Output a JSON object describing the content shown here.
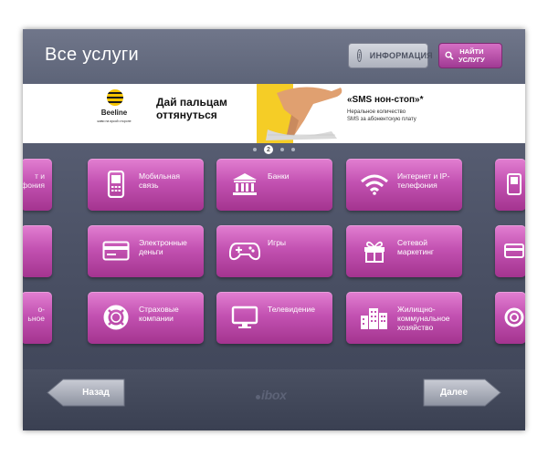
{
  "header": {
    "title": "Все услуги",
    "info_button": {
      "label": "ИНФОРМАЦИЯ",
      "icon": "info-icon"
    },
    "find_button": {
      "label_line1": "НАЙТИ",
      "label_line2": "УСЛУГУ",
      "icon": "search-icon"
    }
  },
  "banner": {
    "brand": "Beeline",
    "slogan": "живи на яркой стороне",
    "headline_line1": "Дай пальцам",
    "headline_line2": "оттянуться",
    "offer_title": "«SMS нон-стоп»*",
    "offer_line1": "Неральное количество",
    "offer_line2": "SMS за абонентскую плату"
  },
  "pager": {
    "current_page": "2",
    "total_dots": 4
  },
  "tiles": [
    {
      "label": "Мобильная связь",
      "icon": "mobile-phone-icon"
    },
    {
      "label": "Банки",
      "icon": "bank-icon"
    },
    {
      "label": "Интернет и IP-телефония",
      "icon": "wifi-icon"
    },
    {
      "label": "Электронные деньги",
      "icon": "credit-card-icon"
    },
    {
      "label": "Игры",
      "icon": "gamepad-icon"
    },
    {
      "label": "Сетевой маркетинг",
      "icon": "gift-icon"
    },
    {
      "label": "Страховые компании",
      "icon": "lifebuoy-icon"
    },
    {
      "label": "Телевидение",
      "icon": "tv-icon"
    },
    {
      "label": "Жилищно-коммунальное хозяйство",
      "icon": "buildings-icon"
    }
  ],
  "side_tiles_left": [
    {
      "label_line1": "т и",
      "label_line2": "фония"
    },
    {
      "label_line1": "",
      "label_line2": ""
    },
    {
      "label_line1": "о-",
      "label_line2": "ьное"
    }
  ],
  "footer": {
    "back_label": "Назад",
    "next_label": "Далее",
    "logo": "ibox"
  },
  "colors": {
    "accent": "#c352b2",
    "background": "#4a5064"
  }
}
